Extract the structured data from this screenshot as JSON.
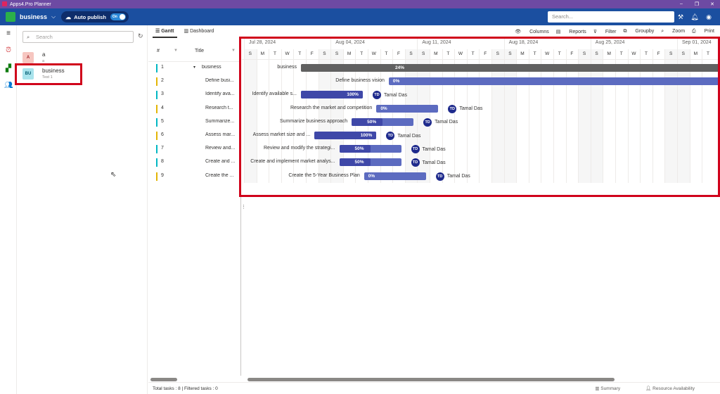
{
  "window": {
    "title": "Apps4.Pro Planner",
    "controls": [
      "–",
      "❐",
      "✕"
    ]
  },
  "header": {
    "plan_name": "business",
    "auto_publish_label": "Auto publish",
    "toggle_label": "On",
    "search_placeholder": "Search..."
  },
  "plans": {
    "search_placeholder": "Search",
    "items": [
      {
        "badge": "A",
        "name": "a",
        "sub": "a",
        "badge_color": "#f6c6c0"
      },
      {
        "badge": "BU",
        "name": "business",
        "sub": "Test 1",
        "badge_color": "#a9e3ec"
      }
    ]
  },
  "tabs": {
    "gantt": "Gantt",
    "dashboard": "Dashboard"
  },
  "toolbar": {
    "columns": "Columns",
    "reports": "Reports",
    "filter": "Filter",
    "groupby": "Groupby",
    "zoom": "Zoom",
    "print": "Print"
  },
  "grid": {
    "col_num": "#",
    "col_title": "Title",
    "rows": [
      {
        "num": "1",
        "title": "business",
        "color": "#00b7c3"
      },
      {
        "num": "2",
        "title": "Define busi...",
        "color": "#e3b505"
      },
      {
        "num": "3",
        "title": "Identify ava...",
        "color": "#00b7c3"
      },
      {
        "num": "4",
        "title": "Research t...",
        "color": "#e3b505"
      },
      {
        "num": "5",
        "title": "Summarize...",
        "color": "#00b7c3"
      },
      {
        "num": "6",
        "title": "Assess mar...",
        "color": "#e3b505"
      },
      {
        "num": "7",
        "title": "Review and...",
        "color": "#00b7c3"
      },
      {
        "num": "8",
        "title": "Create and ...",
        "color": "#00b7c3"
      },
      {
        "num": "9",
        "title": "Create the ...",
        "color": "#e3b505"
      }
    ]
  },
  "timeline": {
    "weeks": [
      "Jul 28, 2024",
      "Aug 04, 2024",
      "Aug 11, 2024",
      "Aug 18, 2024",
      "Aug 25, 2024",
      "Sep 01, 2024"
    ],
    "days": [
      "S",
      "M",
      "T",
      "W",
      "T",
      "F",
      "S",
      "S",
      "M",
      "T",
      "W",
      "T",
      "F",
      "S",
      "S",
      "M",
      "T",
      "W",
      "T",
      "F",
      "S",
      "S",
      "M",
      "T",
      "W",
      "T",
      "F",
      "S",
      "S",
      "M",
      "T",
      "W",
      "T",
      "F",
      "S",
      "S",
      "M",
      "T"
    ]
  },
  "tasks": [
    {
      "label": "business",
      "pct": "24%",
      "start_day": 4.6,
      "dur": 36,
      "progress": 0.24,
      "summary": true,
      "resource": ""
    },
    {
      "label": "Define business vision",
      "pct": "0%",
      "start_day": 11.7,
      "dur": 28,
      "progress": 0,
      "resource": ""
    },
    {
      "label": "Identify available s...",
      "pct": "100%",
      "start_day": 4.6,
      "dur": 5,
      "progress": 1,
      "resource": "Tamal Das",
      "initials": "TD"
    },
    {
      "label": "Research the market and competition",
      "pct": "0%",
      "start_day": 10.7,
      "dur": 5,
      "progress": 0,
      "resource": "Tamal Das",
      "initials": "TD"
    },
    {
      "label": "Summarize business approach",
      "pct": "50%",
      "start_day": 8.7,
      "dur": 5,
      "progress": 0.5,
      "resource": "Tamal Das",
      "initials": "TD"
    },
    {
      "label": "Assess market size and ...",
      "pct": "100%",
      "start_day": 5.7,
      "dur": 5,
      "progress": 1,
      "resource": "Tamal Das",
      "initials": "TD"
    },
    {
      "label": "Review and modify the strategi...",
      "pct": "50%",
      "start_day": 7.7,
      "dur": 5,
      "progress": 0.5,
      "resource": "Tamal Das",
      "initials": "TD"
    },
    {
      "label": "Create and implement market analys...",
      "pct": "50%",
      "start_day": 7.7,
      "dur": 5,
      "progress": 0.5,
      "resource": "Tamal Das",
      "initials": "TD"
    },
    {
      "label": "Create the 5-Year Business Plan",
      "pct": "0%",
      "start_day": 9.7,
      "dur": 5,
      "progress": 0,
      "resource": "Tamal Das",
      "initials": "TD"
    }
  ],
  "footer": {
    "totals": "Total tasks : 8 | Filtered tasks : 0",
    "summary": "Summary",
    "resource_availability": "Resource Availability"
  }
}
